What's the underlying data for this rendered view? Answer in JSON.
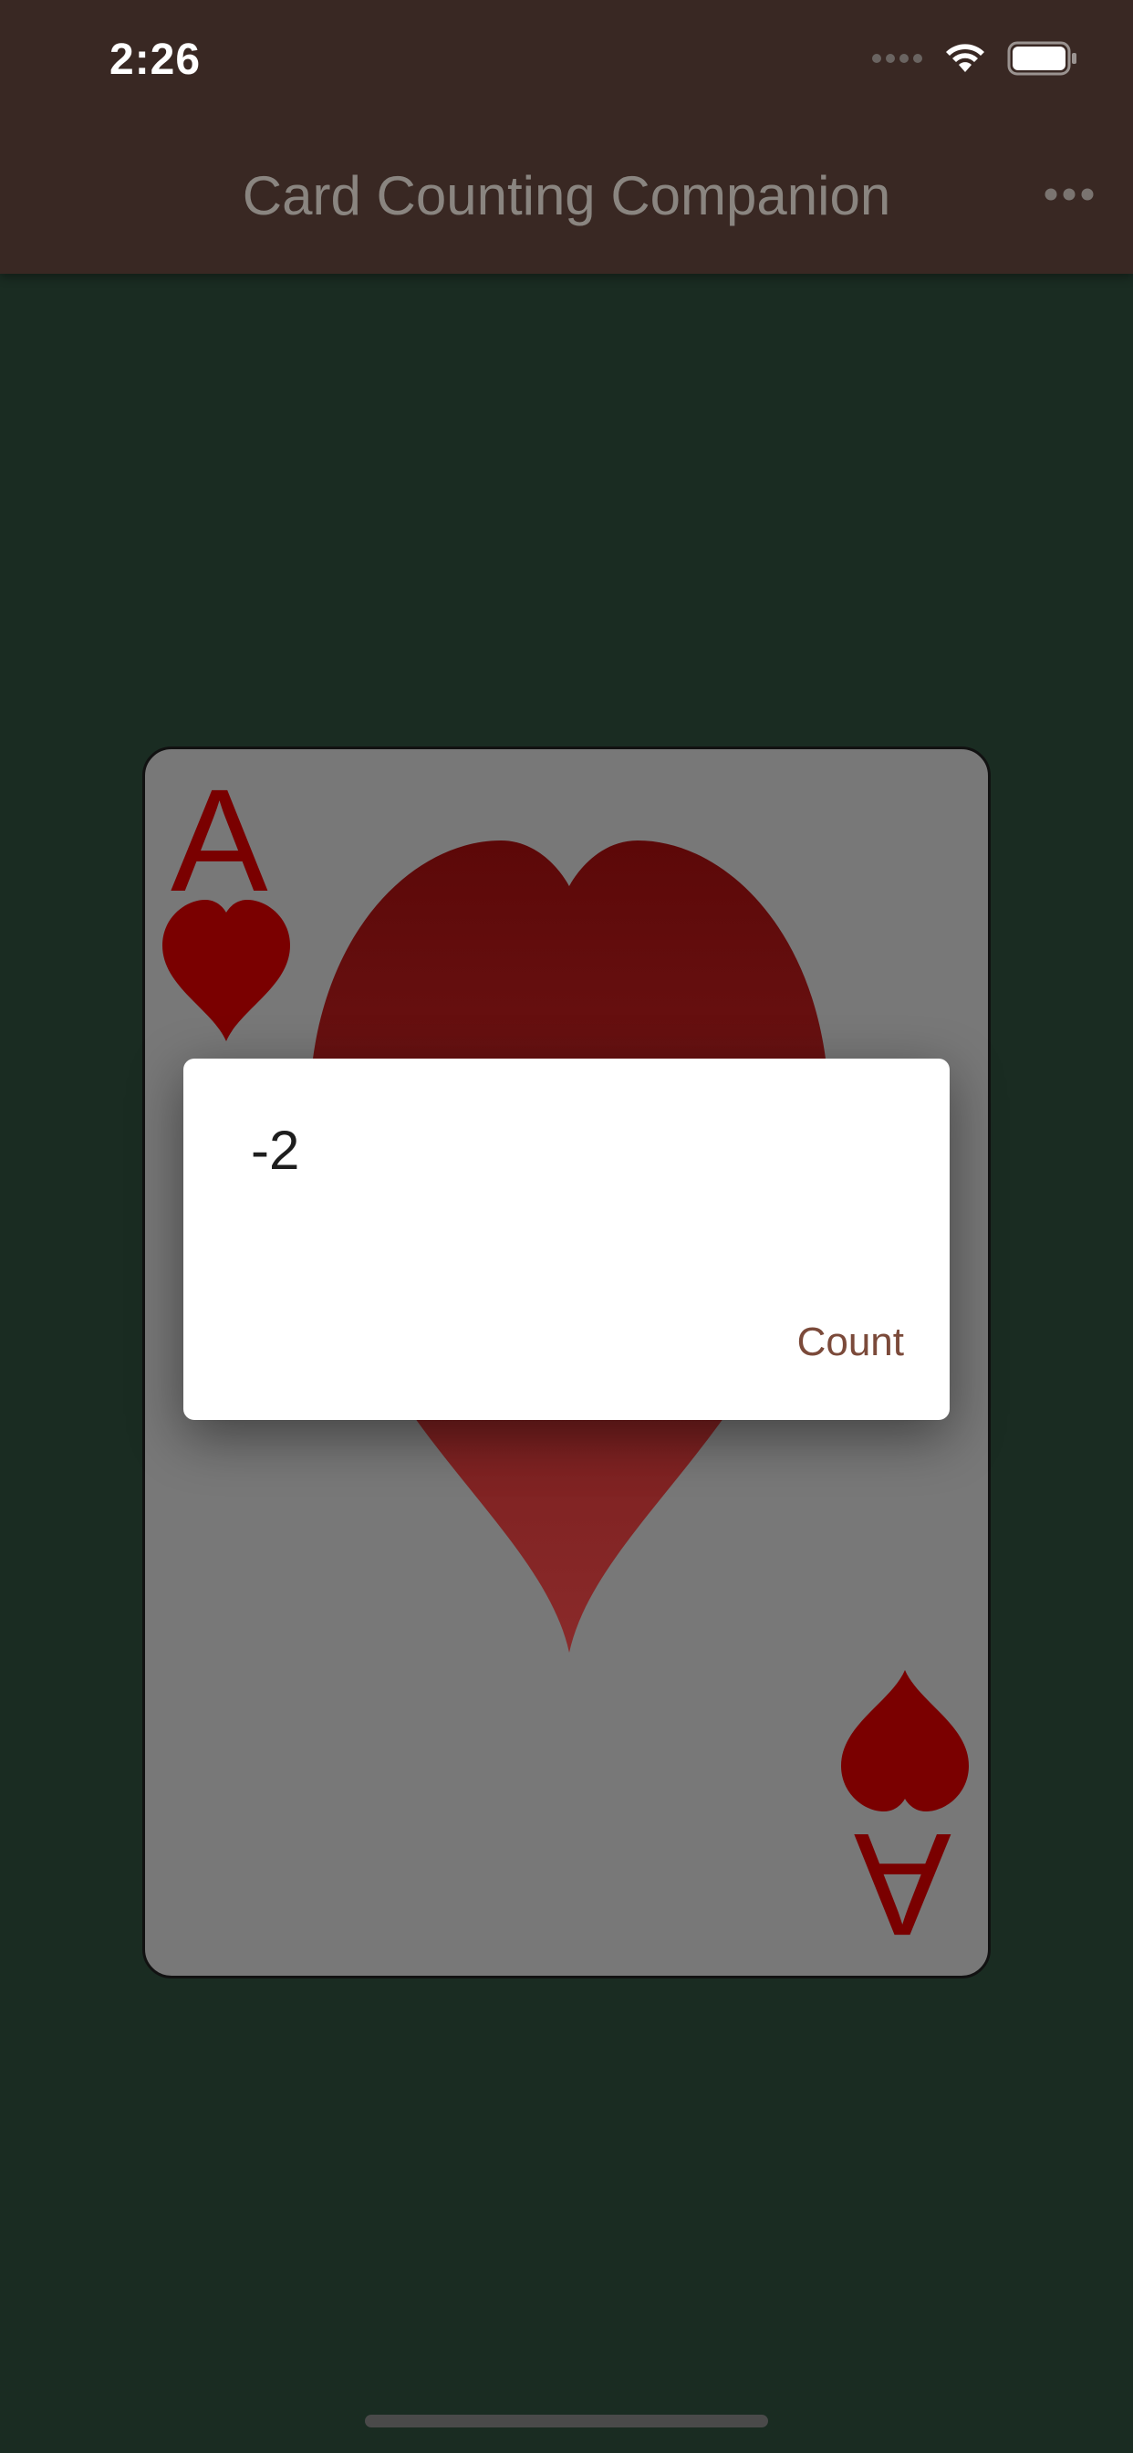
{
  "status_bar": {
    "time": "2:26",
    "icons": [
      "cellular-signal-icon",
      "wifi-icon",
      "battery-icon"
    ]
  },
  "app_bar": {
    "title": "Card Counting Companion",
    "more_icon": "more-horizontal-icon"
  },
  "card": {
    "rank": "A",
    "suit": "hearts",
    "suit_icon": "heart-icon",
    "suit_color": "#7a0000",
    "face_color": "#787878"
  },
  "dialog": {
    "message": "-2",
    "button_label": "Count"
  },
  "colors": {
    "app_bar": "#392823",
    "background": "#1a2c22",
    "title_text": "#8a8580",
    "dialog_button": "#7b4a3a"
  }
}
